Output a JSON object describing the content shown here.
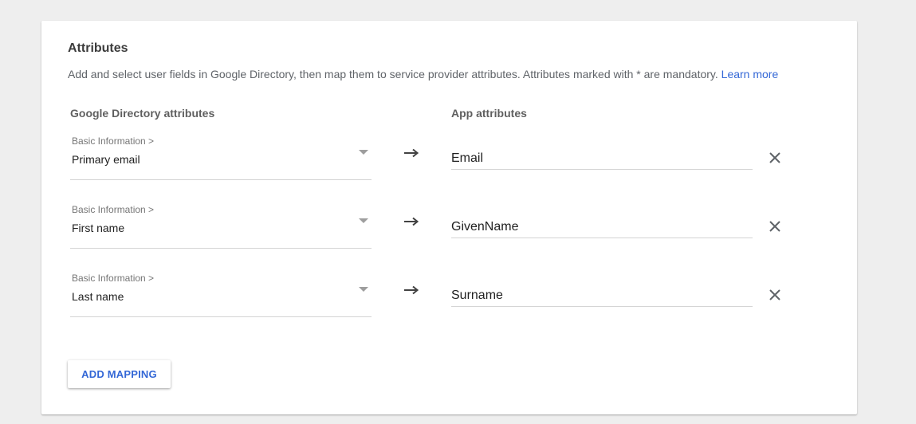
{
  "card": {
    "title": "Attributes",
    "description": "Add and select user fields in Google Directory, then map them to service provider attributes. Attributes marked with * are mandatory.",
    "learn_more": "Learn more"
  },
  "columns": {
    "left": "Google Directory attributes",
    "right": "App attributes"
  },
  "mappings": [
    {
      "group": "Basic Information >",
      "field": "Primary email",
      "app_attribute": "Email"
    },
    {
      "group": "Basic Information >",
      "field": "First name",
      "app_attribute": "GivenName"
    },
    {
      "group": "Basic Information >",
      "field": "Last name",
      "app_attribute": "Surname"
    }
  ],
  "icons": {
    "arrow": "arrow-right-icon",
    "remove": "close-icon",
    "dropdown": "caret-down-icon"
  },
  "buttons": {
    "add_mapping": "ADD MAPPING"
  },
  "colors": {
    "accent": "#3367d6",
    "background": "#eeeeee",
    "card": "#ffffff"
  }
}
